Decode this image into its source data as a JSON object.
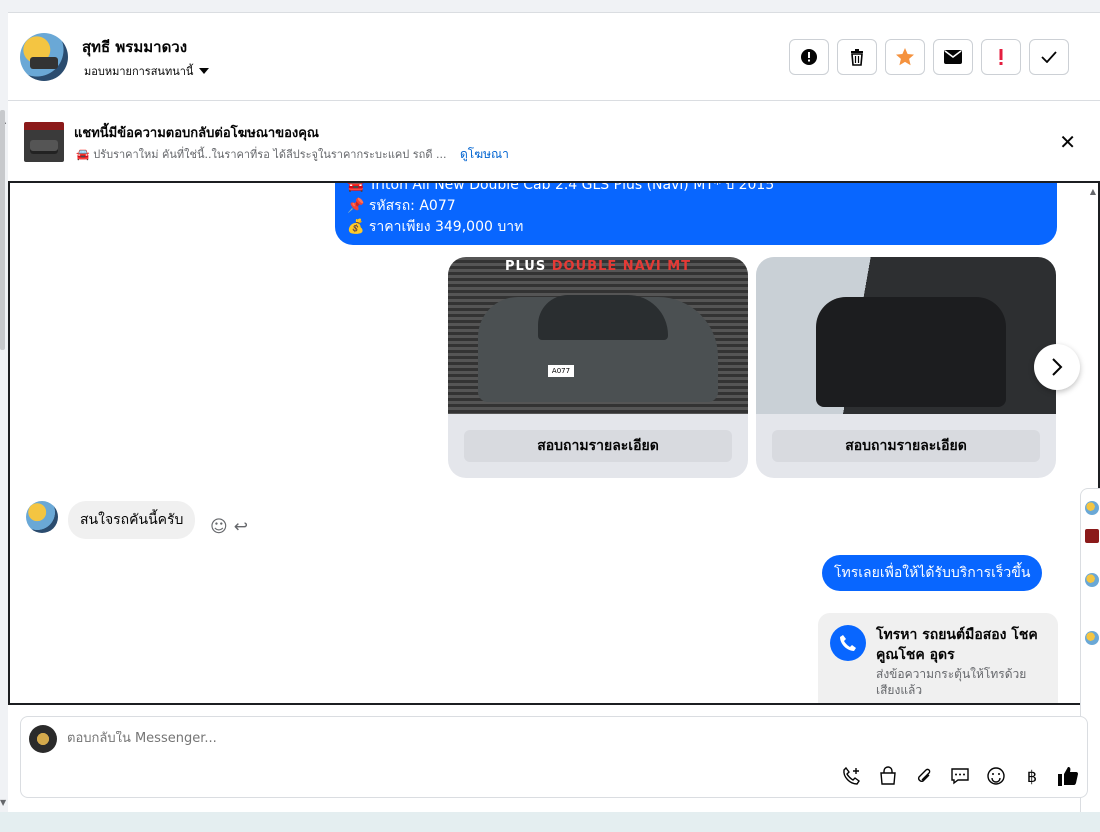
{
  "header": {
    "name": "สุทธี พรมมาดวง",
    "assign_label": "มอบหมายการสนทนานี้"
  },
  "ad_bar": {
    "title": "แชทนี้มีข้อความตอบกลับต่อโฆษณาของคุณ",
    "subtitle": "🚘 ปรับราคาใหม่ คันที่ใช่นี้..ในราคาที่รอ ได้ลีประจูในราคากระบะแคป รถดี ...",
    "link": "ดูโฆษณา"
  },
  "messages": {
    "sent_1": {
      "line1": "🚘 Triton All New Double Cab 2.4 GLS Plus (Navi) MT* ปี 2015",
      "line2": "📌 รหัสรถ:  A077",
      "line3": "💰 ราคาเพียง 349,000 บาท"
    },
    "cards": [
      {
        "button": "สอบถามรายละเอียด",
        "banner_white": "PLUS",
        "banner_red": " DOUBLE NAVI MT",
        "plate": "A077"
      },
      {
        "button": "สอบถามรายละเอียด"
      }
    ],
    "received_1": "สนใจรถคันนี้ครับ",
    "sent_2": "โทรเลยเพื่อให้ได้รับบริการเร็วขึ้น",
    "call_card": {
      "title": "โทรหา รถยนต์มือสอง โชคคูณโชค อุดร",
      "subtitle": "ส่งข้อความกระตุ้นให้โทรด้วยเสียงแล้ว"
    }
  },
  "composer": {
    "placeholder": "ตอบกลับใน Messenger..."
  },
  "colors": {
    "accent": "#0866ff",
    "star": "#f5923e",
    "alert": "#e41e3f"
  }
}
